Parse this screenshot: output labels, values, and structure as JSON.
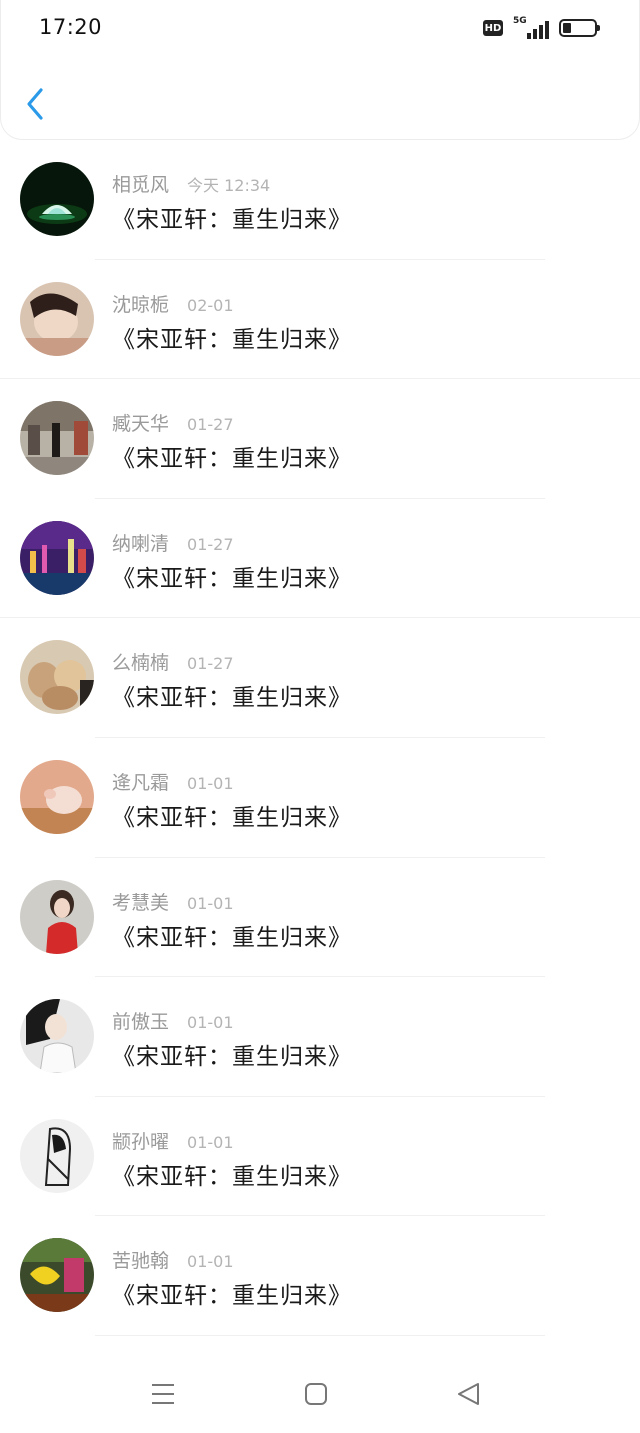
{
  "status_bar": {
    "time": "17:20",
    "hd_label": "HD",
    "network_label": "5G",
    "battery_level": 0.25
  },
  "header": {
    "back_icon": "chevron-left-icon",
    "accent_color": "#2b9ae8"
  },
  "items": [
    {
      "name": "相觅风",
      "date": "今天 12:34",
      "message": "《宋亚轩：重生归来》"
    },
    {
      "name": "沈晾栀",
      "date": "02-01",
      "message": "《宋亚轩：重生归来》"
    },
    {
      "name": "臧天华",
      "date": "01-27",
      "message": "《宋亚轩：重生归来》"
    },
    {
      "name": "纳喇清",
      "date": "01-27",
      "message": "《宋亚轩：重生归来》"
    },
    {
      "name": "么楠楠",
      "date": "01-27",
      "message": "《宋亚轩：重生归来》"
    },
    {
      "name": "逄凡霜",
      "date": "01-01",
      "message": "《宋亚轩：重生归来》"
    },
    {
      "name": "考慧美",
      "date": "01-01",
      "message": "《宋亚轩：重生归来》"
    },
    {
      "name": "前傲玉",
      "date": "01-01",
      "message": "《宋亚轩：重生归来》"
    },
    {
      "name": "颛孙曜",
      "date": "01-01",
      "message": "《宋亚轩：重生归来》"
    },
    {
      "name": "苦驰翰",
      "date": "01-01",
      "message": "《宋亚轩：重生归来》"
    }
  ],
  "nav_bar": {
    "icons": [
      "menu-icon",
      "home-square-icon",
      "back-triangle-icon"
    ]
  }
}
